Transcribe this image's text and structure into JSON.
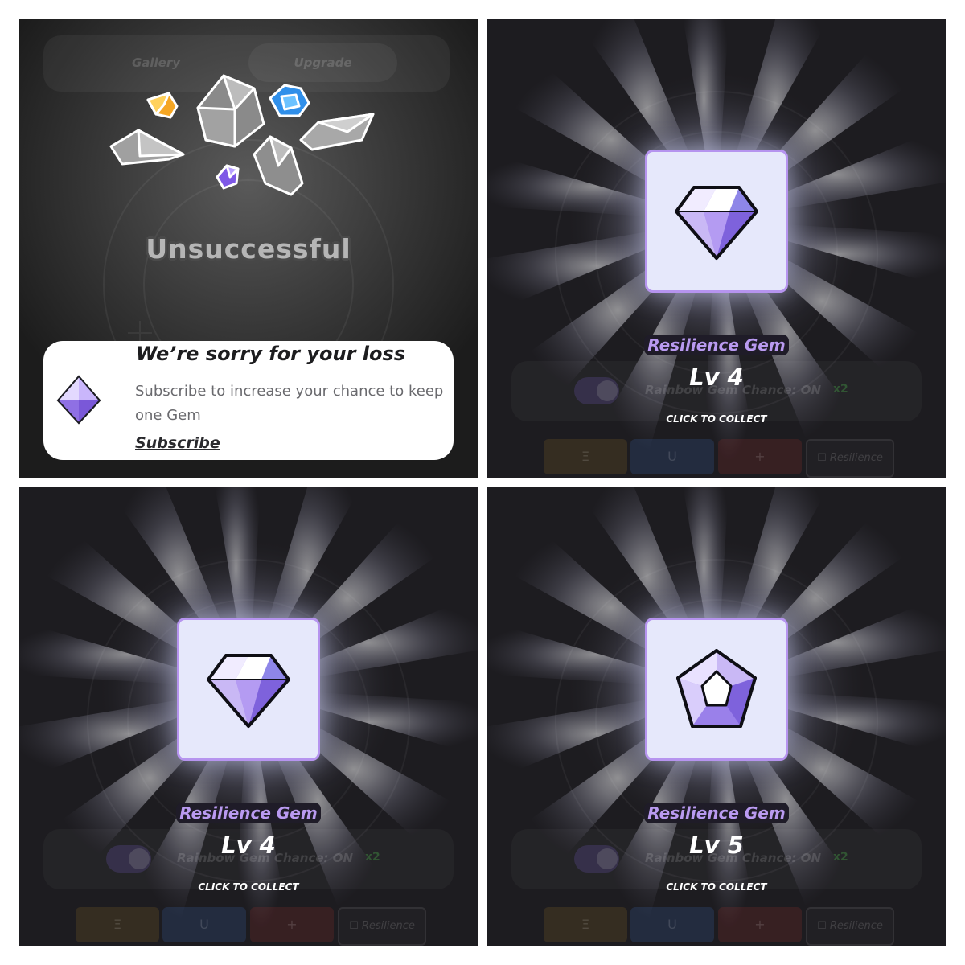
{
  "panel1": {
    "tabs": [
      {
        "label": "Gallery"
      },
      {
        "label": "Upgrade"
      }
    ],
    "status_title": "Unsuccessful",
    "notice": {
      "title": "We’re sorry for your loss",
      "body": "Subscribe to increase your chance to keep one Gem",
      "link": "Subscribe",
      "icon": "gem-icon"
    }
  },
  "panel2": {
    "gem_name": "Resilience Gem",
    "level": "Lv 4",
    "collect": "CLICK TO COLLECT",
    "chance_text": "Rainbow Gem Chance: ON",
    "multiplier": "x2",
    "buttons": [
      {
        "label": "Ξ"
      },
      {
        "label": "U"
      },
      {
        "label": "+"
      },
      {
        "label": "☐ Resilience"
      }
    ]
  },
  "panel3": {
    "gem_name": "Resilience Gem",
    "level": "Lv 4",
    "collect": "CLICK TO COLLECT",
    "chance_text": "Rainbow Gem Chance: ON",
    "multiplier": "x2",
    "buttons": [
      {
        "label": "Ξ"
      },
      {
        "label": "U"
      },
      {
        "label": "+"
      },
      {
        "label": "☐ Resilience"
      }
    ]
  },
  "panel4": {
    "gem_name": "Resilience Gem",
    "level": "Lv 5",
    "collect": "CLICK TO COLLECT",
    "chance_text": "Rainbow Gem Chance: ON",
    "multiplier": "x2",
    "buttons": [
      {
        "label": "Ξ"
      },
      {
        "label": "U"
      },
      {
        "label": "+"
      },
      {
        "label": "☐ Resilience"
      }
    ]
  },
  "colors": {
    "background": "#1b1a1c",
    "card_border": "#b694ef",
    "card_fill": "#e6e8fb",
    "gem_name": "#b99af0",
    "gem_light": "#ffffff",
    "gem_mid": "#c9b8f5",
    "gem_dark": "#9a7ee6"
  }
}
